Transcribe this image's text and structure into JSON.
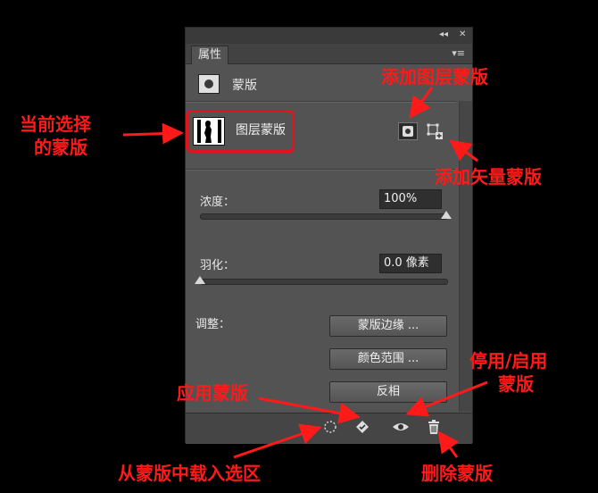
{
  "panel": {
    "tab_label": "属性",
    "collapse_glyph": "◂◂",
    "close_glyph": "✕",
    "menu_glyph": "▾≡",
    "section_title": "蒙版",
    "layer_mask_label": "图层蒙版",
    "density_label": "浓度：",
    "density_value": "100%",
    "density_level": 1.0,
    "feather_label": "羽化：",
    "feather_value": "0.0 像素",
    "feather_level": 0.0,
    "adjust_label": "调整：",
    "buttons": {
      "mask_edge": "蒙版边缘 ...",
      "color_range": "颜色范围 ...",
      "invert": "反相"
    }
  },
  "annotations": {
    "current_mask_line1": "当前选择",
    "current_mask_line2": "的蒙版",
    "add_layer_mask": "添加图层蒙版",
    "add_vector_mask": "添加矢量蒙版",
    "apply_mask": "应用蒙版",
    "disable_enable_line1": "停用/启用",
    "disable_enable_line2": "蒙版",
    "load_selection": "从蒙版中载入选区",
    "delete_mask": "删除蒙版"
  },
  "colors": {
    "annotation": "#ff1a1a",
    "panel_bg": "#535353",
    "page_bg": "#000000"
  }
}
